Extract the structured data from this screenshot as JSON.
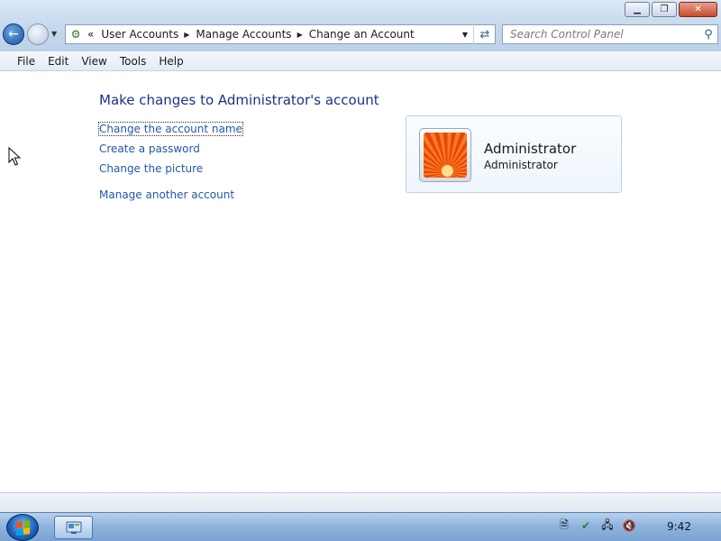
{
  "window": {
    "controls": {
      "minimize": "▁",
      "restore": "❐",
      "close": "✕"
    }
  },
  "addressbar": {
    "icon": "control-panel-icon",
    "overflow": "«",
    "crumbs": [
      "User Accounts",
      "Manage Accounts",
      "Change an Account"
    ]
  },
  "search": {
    "placeholder": "Search Control Panel"
  },
  "menu": [
    "File",
    "Edit",
    "View",
    "Tools",
    "Help"
  ],
  "content": {
    "heading": "Make changes to Administrator's account",
    "links": {
      "change_name": "Change the account name",
      "create_password": "Create a password",
      "change_picture": "Change the picture",
      "manage_another": "Manage another account"
    }
  },
  "account": {
    "name": "Administrator",
    "type": "Administrator",
    "picture": "flower-icon"
  },
  "taskbar": {
    "clock": "9:42",
    "tray_icons": [
      "notepad-icon",
      "security-shield-icon",
      "network-icon",
      "volume-muted-icon"
    ],
    "colors": {
      "accent": "#1c4f9b"
    }
  }
}
